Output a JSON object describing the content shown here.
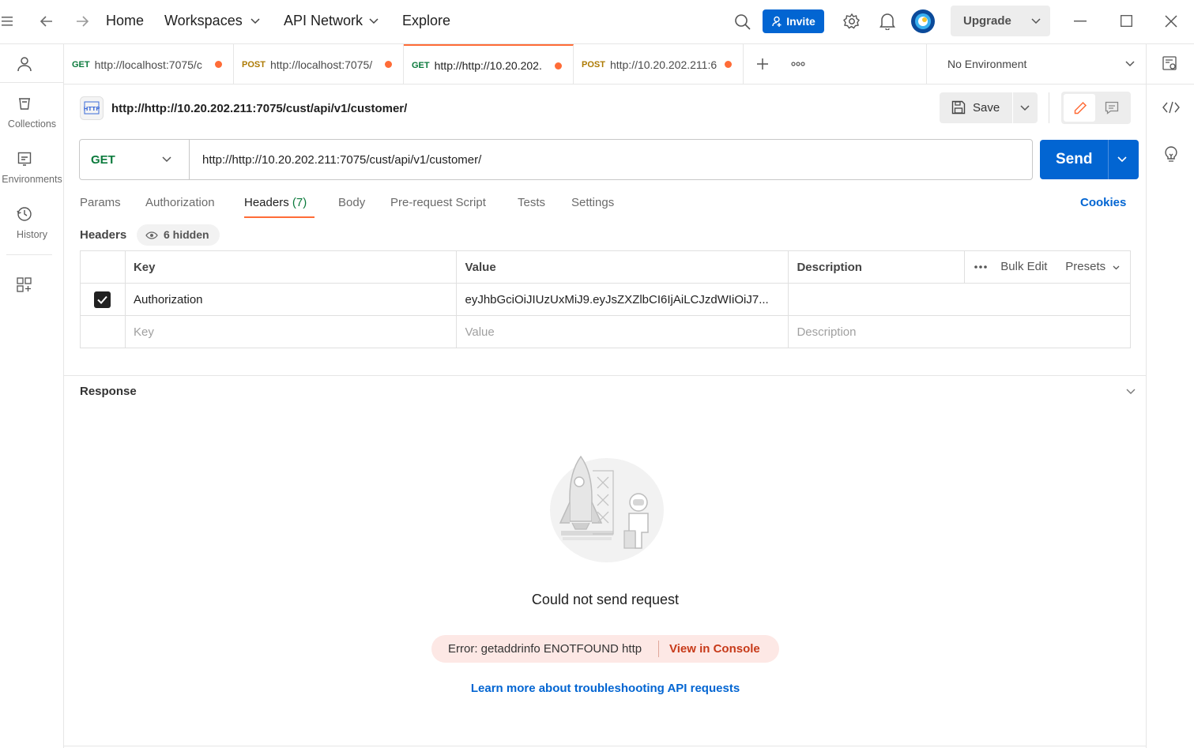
{
  "topbar": {
    "home": "Home",
    "workspaces": "Workspaces",
    "api_network": "API Network",
    "explore": "Explore",
    "invite": "Invite",
    "upgrade": "Upgrade"
  },
  "sidebar": {
    "collections": "Collections",
    "environments": "Environments",
    "history": "History"
  },
  "tabs": [
    {
      "method": "GET",
      "label": "http://localhost:7075/c"
    },
    {
      "method": "POST",
      "label": "http://localhost:7075/"
    },
    {
      "method": "GET",
      "label": "http://http://10.20.202."
    },
    {
      "method": "POST",
      "label": "http://10.20.202.211:6"
    }
  ],
  "environment": "No Environment",
  "request": {
    "title": "http://http://10.20.202.211:7075/cust/api/v1/customer/",
    "save": "Save",
    "method": "GET",
    "url": "http://http://10.20.202.211:7075/cust/api/v1/customer/",
    "send": "Send"
  },
  "subtabs": {
    "params": "Params",
    "authorization": "Authorization",
    "headers": "Headers",
    "headers_count": "(7)",
    "body": "Body",
    "prerequest": "Pre-request Script",
    "tests": "Tests",
    "settings": "Settings",
    "cookies": "Cookies"
  },
  "headers_section": {
    "title": "Headers",
    "hidden": "6 hidden",
    "columns": {
      "key": "Key",
      "value": "Value",
      "description": "Description"
    },
    "bulk_edit": "Bulk Edit",
    "presets": "Presets",
    "rows": [
      {
        "checked": true,
        "key": "Authorization",
        "value": "eyJhbGciOiJIUzUxMiJ9.eyJsZXZlbCI6IjAiLCJzdWIiOiJ7...",
        "description": ""
      }
    ],
    "placeholder": {
      "key": "Key",
      "value": "Value",
      "description": "Description"
    }
  },
  "response": {
    "title": "Response",
    "empty_message": "Could not send request",
    "error": "Error: getaddrinfo ENOTFOUND http",
    "view_console": "View in Console",
    "learn_more": "Learn more about troubleshooting API requests"
  },
  "colors": {
    "accent": "#0265d2",
    "orange": "#ff6c37",
    "get": "#0b7a3c",
    "post": "#ad7a03",
    "error": "#c73a19"
  }
}
